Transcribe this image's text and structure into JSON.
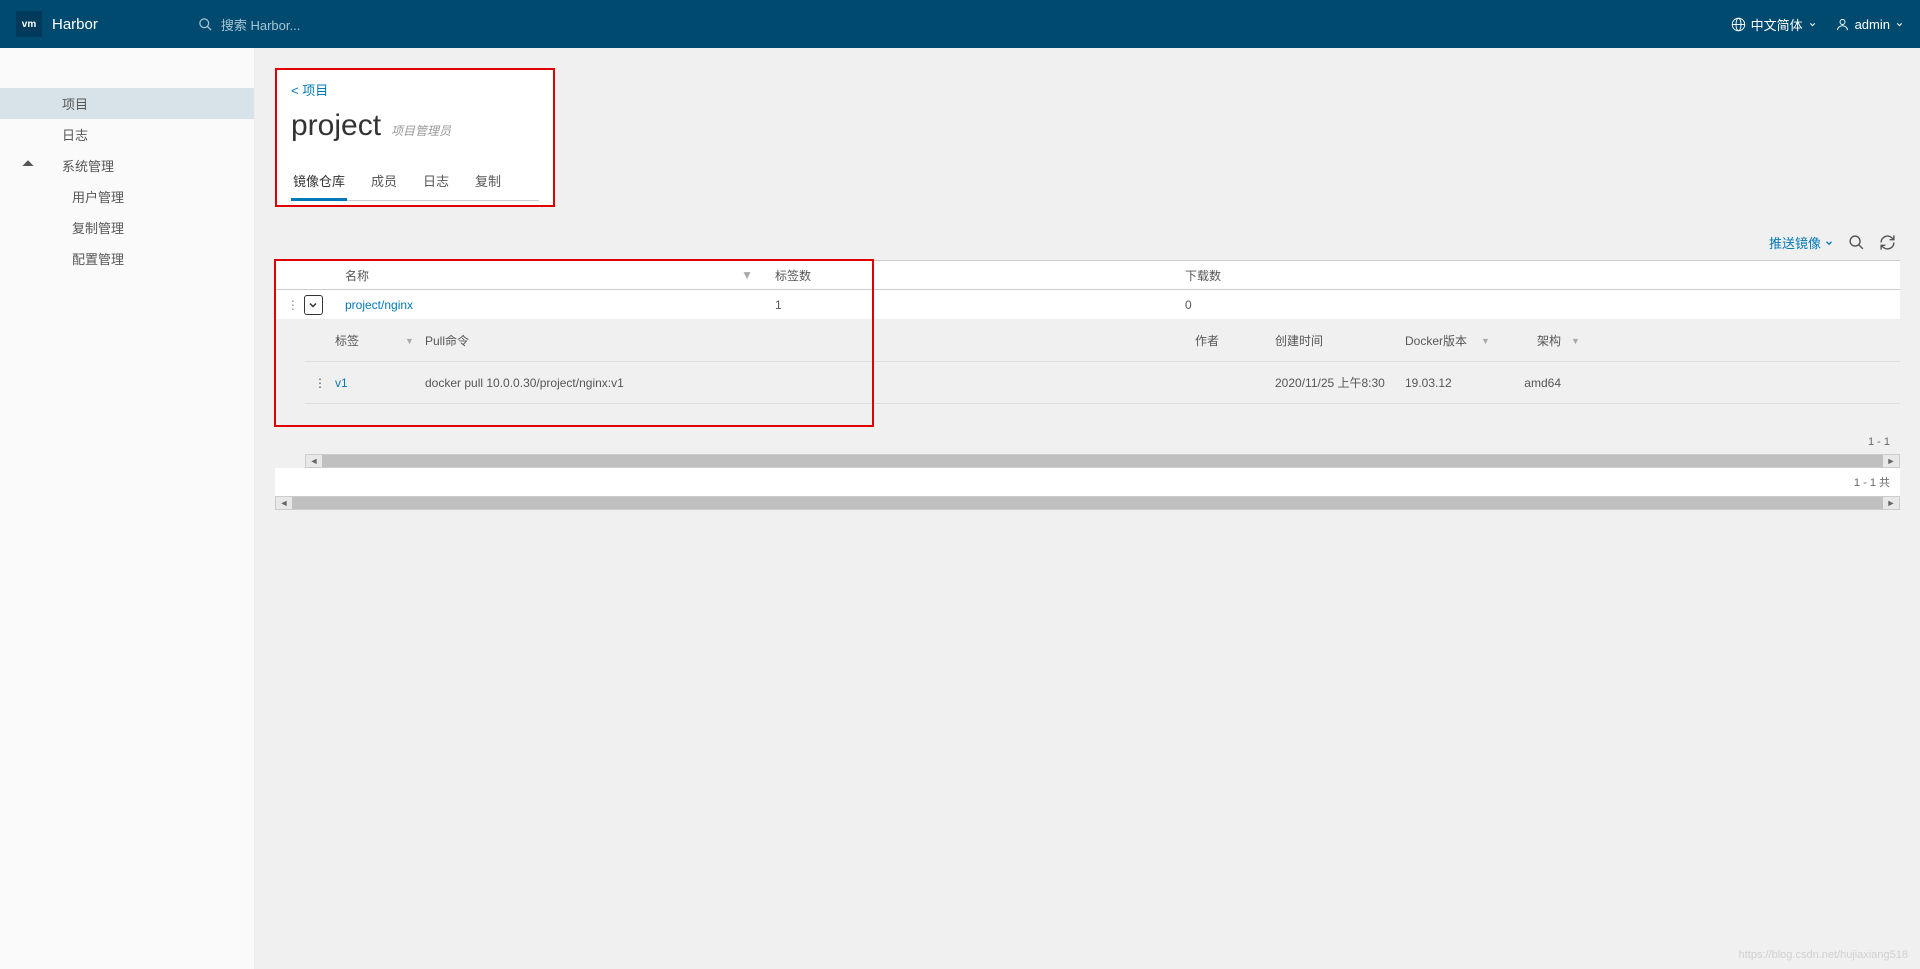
{
  "header": {
    "logo": "vm",
    "brand": "Harbor",
    "search_placeholder": "搜索 Harbor...",
    "language": "中文简体",
    "user": "admin"
  },
  "sidebar": {
    "items": [
      {
        "label": "项目",
        "active": true
      },
      {
        "label": "日志"
      },
      {
        "label": "系统管理",
        "group": true
      },
      {
        "label": "用户管理",
        "sub": true
      },
      {
        "label": "复制管理",
        "sub": true
      },
      {
        "label": "配置管理",
        "sub": true
      }
    ]
  },
  "breadcrumb": "< 项目",
  "project": {
    "title": "project",
    "role": "项目管理员"
  },
  "tabs": [
    {
      "label": "镜像仓库",
      "active": true
    },
    {
      "label": "成员"
    },
    {
      "label": "日志"
    },
    {
      "label": "复制"
    }
  ],
  "toolbar": {
    "push": "推送镜像"
  },
  "table": {
    "headers": {
      "name": "名称",
      "tags": "标签数",
      "pulls": "下载数"
    },
    "rows": [
      {
        "name": "project/nginx",
        "tags": "1",
        "pulls": "0"
      }
    ]
  },
  "subtable": {
    "headers": {
      "tag": "标签",
      "pull": "Pull命令",
      "author": "作者",
      "created": "创建时间",
      "docker": "Docker版本",
      "arch": "架构"
    },
    "rows": [
      {
        "tag": "v1",
        "pull": "docker pull 10.0.0.30/project/nginx:v1",
        "author": "",
        "created": "2020/11/25 上午8:30",
        "docker": "19.03.12",
        "arch": "amd64"
      }
    ]
  },
  "pagination": {
    "inner": "1 - 1",
    "outer": "1 - 1 共"
  },
  "watermark": "https://blog.csdn.net/hujiaxiang518"
}
